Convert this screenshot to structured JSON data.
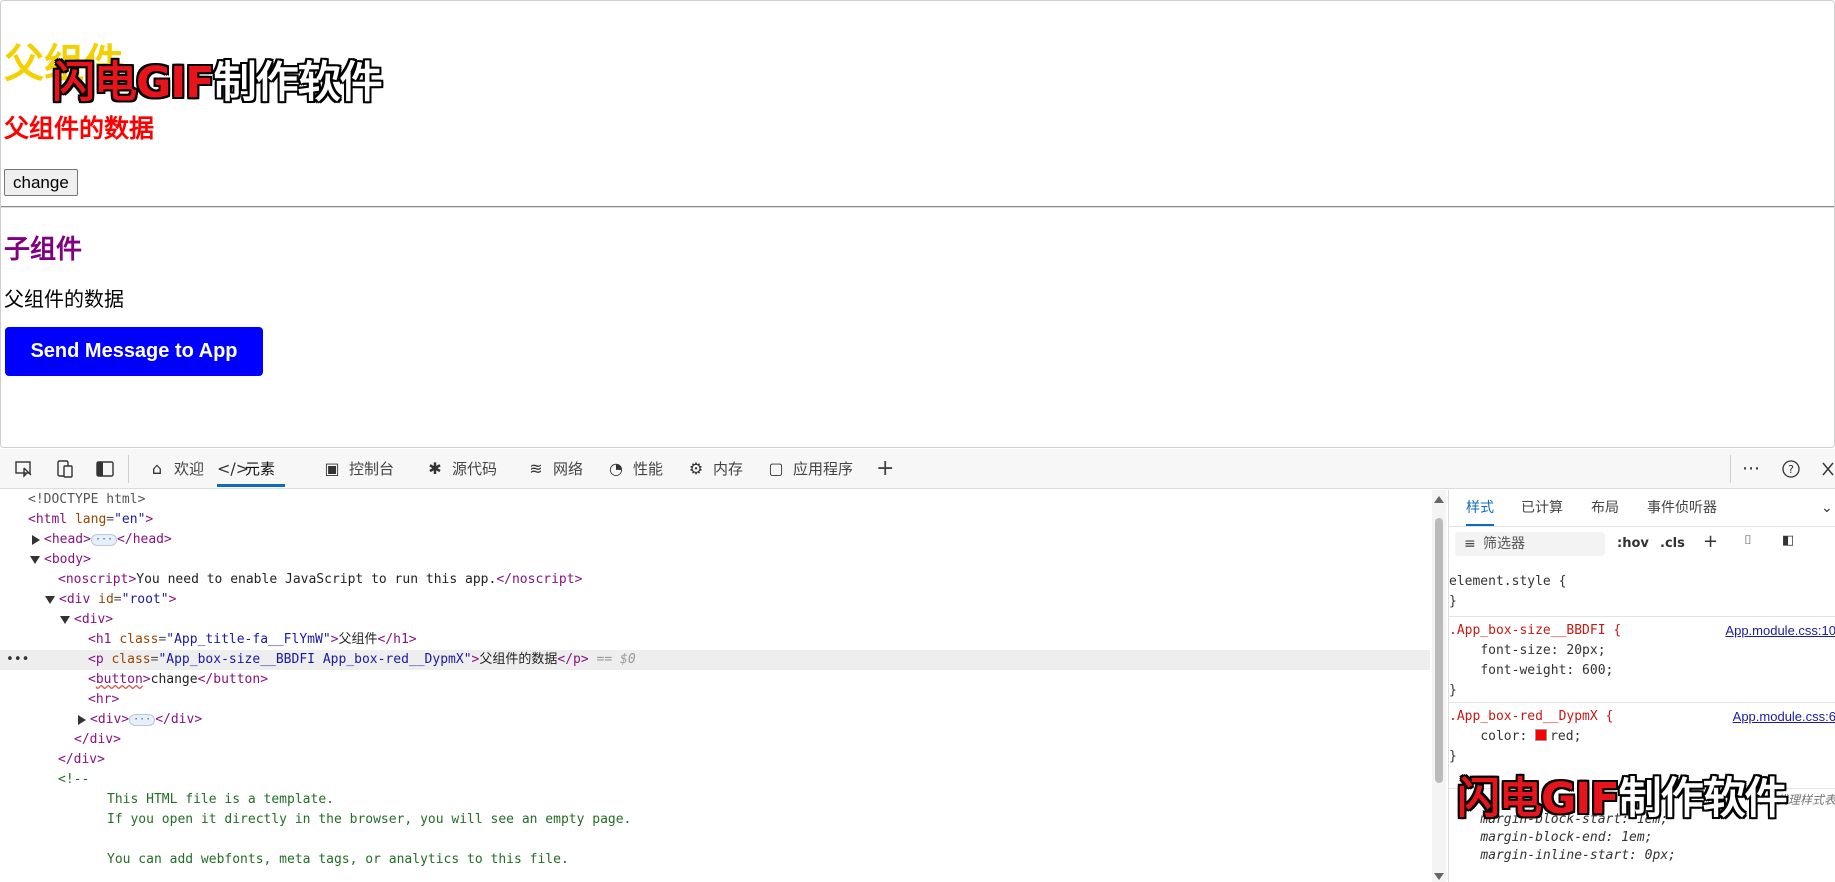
{
  "page": {
    "title": "父组件",
    "red_text": "父组件的数据",
    "change_button": "change",
    "child_title": "子组件",
    "child_text": "父组件的数据",
    "send_button": "Send Message to App"
  },
  "watermark": {
    "red": "闪电GIF",
    "white": "制作软件"
  },
  "devtools": {
    "toolbar": {
      "tabs": [
        {
          "label": "欢迎",
          "icon": "home-icon"
        },
        {
          "label": "元素",
          "icon": "code-icon"
        },
        {
          "label": "控制台",
          "icon": "console-icon"
        },
        {
          "label": "源代码",
          "icon": "bug-icon"
        },
        {
          "label": "网络",
          "icon": "wifi-icon"
        },
        {
          "label": "性能",
          "icon": "speedometer-icon"
        },
        {
          "label": "内存",
          "icon": "memory-chip-icon"
        },
        {
          "label": "应用程序",
          "icon": "app-window-icon"
        }
      ],
      "add_tab": "+"
    },
    "dom": {
      "doctype": "<!DOCTYPE html>",
      "html_open": "html",
      "lang_attr": "lang",
      "lang_val": "\"en\"",
      "head": "head",
      "body": "body",
      "noscript_text": "You need to enable JavaScript to run this app.",
      "div_root_attr": "id",
      "div_root_val": "\"root\"",
      "h1_class": "\"App_title-fa__FlYmW\"",
      "h1_text": "父组件",
      "p_class": "\"App_box-size__BBDFI App_box-red__DypmX\"",
      "p_text": "父组件的数据",
      "selected_marker": "== $0",
      "button_text": "change",
      "comment_open": "<!--",
      "comment_1": "This HTML file is a template.",
      "comment_2": "If you open it directly in the browser, you will see an empty page.",
      "comment_3": "You can add webfonts, meta tags, or analytics to this file."
    },
    "styles": {
      "tabs": [
        "样式",
        "已计算",
        "布局",
        "事件侦听器"
      ],
      "filter_placeholder": "筛选器",
      "hov": ":hov",
      "cls": ".cls",
      "element_style": "element.style {",
      "rule1_selector": ".App_box-size__BBDFI {",
      "rule1_link": "App.module.css:10",
      "rule1_props": [
        "font-size: 20px;",
        "font-weight: 600;"
      ],
      "rule2_selector": ".App_box-red__DypmX {",
      "rule2_link": "App.module.css:6",
      "rule2_color_prop": "color:",
      "rule2_color_val": "red;",
      "ua_label": "用户代理样式表",
      "ua_props": [
        "margin-block-start: 1em;",
        "margin-block-end: 1em;",
        "margin-inline-start: 0px;"
      ]
    }
  }
}
